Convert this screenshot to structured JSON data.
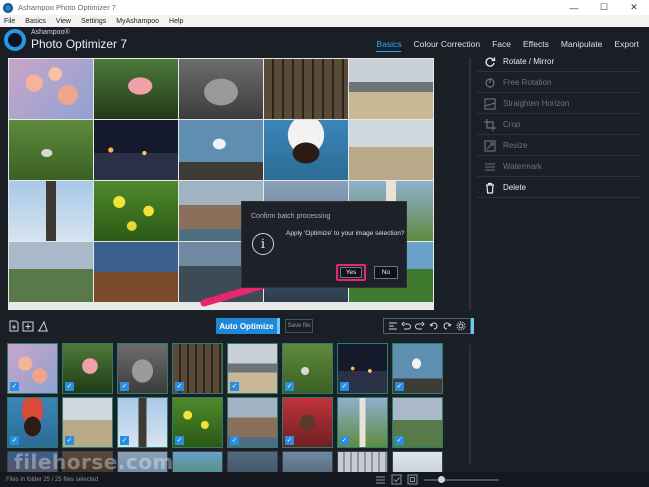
{
  "window": {
    "title": "Ashampoo Photo Optimizer 7",
    "minimize": "—",
    "maximize": "☐",
    "close": "✕"
  },
  "menu": [
    "File",
    "Basics",
    "View",
    "Settings",
    "MyAshampoo",
    "Help"
  ],
  "brand": {
    "small": "Ashampoo®",
    "big": "Photo Optimizer 7"
  },
  "tabs": [
    {
      "label": "Basics",
      "active": true
    },
    {
      "label": "Colour Correction",
      "active": false
    },
    {
      "label": "Face",
      "active": false
    },
    {
      "label": "Effects",
      "active": false
    },
    {
      "label": "Manipulate",
      "active": false
    },
    {
      "label": "Export",
      "active": false
    }
  ],
  "right_panel": [
    {
      "label": "Rotate / Mirror",
      "icon": "rotate-icon",
      "enabled": true
    },
    {
      "label": "Free Rotation",
      "icon": "free-rotation-icon",
      "enabled": false
    },
    {
      "label": "Straighten Horizon",
      "icon": "straighten-icon",
      "enabled": false
    },
    {
      "label": "Crop",
      "icon": "crop-icon",
      "enabled": false
    },
    {
      "label": "Resize",
      "icon": "resize-icon",
      "enabled": false
    },
    {
      "label": "Watermark",
      "icon": "watermark-icon",
      "enabled": false
    },
    {
      "label": "Delete",
      "icon": "trash-icon",
      "enabled": true
    }
  ],
  "dialog": {
    "title": "Confirm batch processing",
    "message": "Apply 'Optimize' to your image selection?",
    "yes": "Yes",
    "no": "No"
  },
  "toolbar": {
    "auto_optimize": "Auto Optimize",
    "save_file": "Save file"
  },
  "status": {
    "text": "Files in folder 25 / 25 files selected"
  },
  "watermark": "filehorse.com",
  "colors": {
    "accent": "#1e88d8",
    "highlight": "#e5276f",
    "background": "#1b2027"
  }
}
